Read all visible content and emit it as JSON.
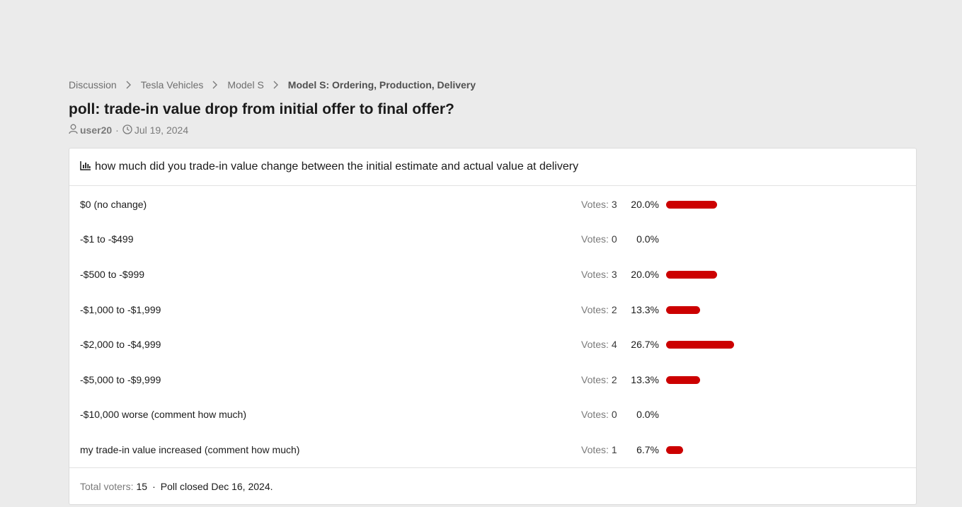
{
  "breadcrumb": [
    {
      "label": "Discussion"
    },
    {
      "label": "Tesla Vehicles"
    },
    {
      "label": "Model S"
    },
    {
      "label": "Model S: Ordering, Production, Delivery"
    }
  ],
  "thread": {
    "title": "poll: trade-in value drop from initial offer to final offer?",
    "author": "user20",
    "separator": "·",
    "date": "Jul 19, 2024"
  },
  "poll": {
    "question": "how much did you trade-in value change between the initial estimate and actual value at delivery",
    "votes_label": "Votes:",
    "bar_color": "#cc0000",
    "options": [
      {
        "label": "$0 (no change)",
        "votes": "3",
        "percent": "20.0%",
        "fraction": 0.2
      },
      {
        "label": "-$1 to -$499",
        "votes": "0",
        "percent": "0.0%",
        "fraction": 0.0
      },
      {
        "label": "-$500 to -$999",
        "votes": "3",
        "percent": "20.0%",
        "fraction": 0.2
      },
      {
        "label": "-$1,000 to -$1,999",
        "votes": "2",
        "percent": "13.3%",
        "fraction": 0.133
      },
      {
        "label": "-$2,000 to -$4,999",
        "votes": "4",
        "percent": "26.7%",
        "fraction": 0.267
      },
      {
        "label": "-$5,000 to -$9,999",
        "votes": "2",
        "percent": "13.3%",
        "fraction": 0.133
      },
      {
        "label": "-$10,000 worse (comment how much)",
        "votes": "0",
        "percent": "0.0%",
        "fraction": 0.0
      },
      {
        "label": "my trade-in value increased (comment how much)",
        "votes": "1",
        "percent": "6.7%",
        "fraction": 0.067
      }
    ],
    "footer": {
      "total_label": "Total voters:",
      "total": "15",
      "separator": "·",
      "closed": "Poll closed Dec 16, 2024."
    }
  },
  "icons": {
    "user": "user-icon",
    "clock": "clock-icon",
    "chart": "bar-chart-icon",
    "separator": "chevron-right-icon"
  }
}
